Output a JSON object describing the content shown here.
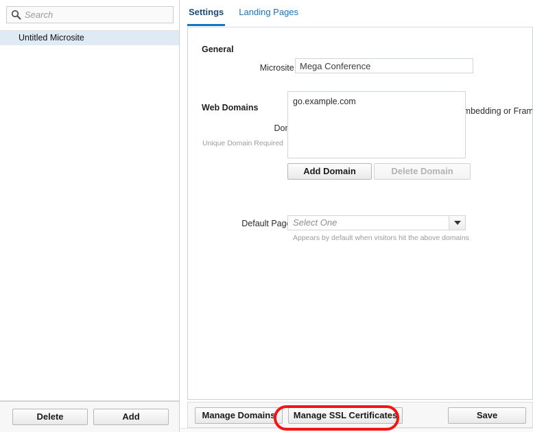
{
  "sidebar": {
    "search": {
      "icon": "search-icon",
      "placeholder": "Search",
      "value": ""
    },
    "items": [
      {
        "label": "Untitled Microsite",
        "selected": true
      }
    ],
    "footer": {
      "delete_label": "Delete",
      "add_label": "Add"
    }
  },
  "main": {
    "tabs": [
      {
        "label": "Settings",
        "active": true
      },
      {
        "label": "Landing Pages",
        "active": false
      }
    ],
    "general": {
      "section_title": "General",
      "microsite_name_label": "Microsite Name:",
      "microsite_name_value": "Mega Conference",
      "microsite_name_placeholder": "",
      "allow_embedding_label": "Allow Embedding or Framing",
      "allow_embedding_checked": false
    },
    "web_domains": {
      "section_title": "Web Domains",
      "domain_list_label": "Domain List:",
      "domain_list_helper": "Unique Domain Required",
      "domains": [
        "go.example.com"
      ],
      "add_domain_label": "Add Domain",
      "delete_domain_label": "Delete Domain",
      "delete_domain_disabled": true,
      "default_page_label": "Default Page:",
      "default_page_value": "Select One",
      "default_page_helper": "Appears by default when visitors hit the above domains",
      "dropdown_icon": "chevron-down-icon"
    },
    "footer": {
      "manage_domains_label": "Manage Domains",
      "manage_ssl_label": "Manage SSL Certificates",
      "save_label": "Save"
    }
  },
  "annotation": {
    "target": "manage-ssl-certificates-button",
    "color": "#f41414"
  },
  "colors": {
    "accent_blue": "#1474c4",
    "tab_active": "#1a4d7a",
    "tab_inactive": "#1a72bb",
    "selected_row": "#dfeaf5",
    "checkbox_border": "#3c7fc4",
    "annotation_red": "#f41414"
  }
}
